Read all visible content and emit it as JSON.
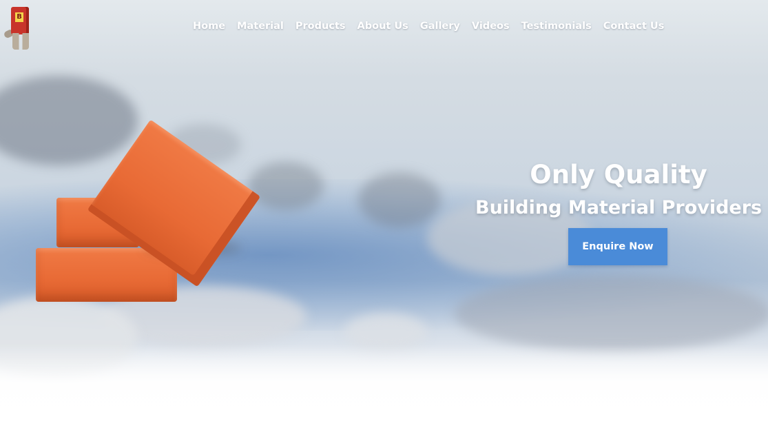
{
  "nav": {
    "items": [
      {
        "label": "Home"
      },
      {
        "label": "Material"
      },
      {
        "label": "Products"
      },
      {
        "label": "About Us"
      },
      {
        "label": "Gallery"
      },
      {
        "label": "Videos"
      },
      {
        "label": "Testimonials"
      },
      {
        "label": "Contact Us"
      }
    ]
  },
  "logo": {
    "tag_text": "B"
  },
  "hero": {
    "headline": "Only Quality",
    "subline": "Building Material Providers",
    "cta_label": "Enquire Now"
  },
  "colors": {
    "cta_bg": "#4a8bd8",
    "text": "#ffffff",
    "brick": "#e86a35"
  }
}
